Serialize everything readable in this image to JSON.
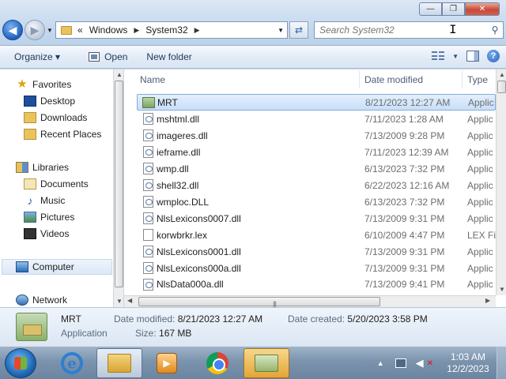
{
  "address": {
    "prefix": "«",
    "crumbs": [
      "Windows",
      "System32"
    ]
  },
  "search": {
    "placeholder": "Search System32"
  },
  "caption": {
    "minimize": "—",
    "maximize": "❐",
    "close": "✕"
  },
  "toolbar": {
    "organize": "Organize ▾",
    "open": "Open",
    "new_folder": "New folder"
  },
  "nav": {
    "favorites": "Favorites",
    "desktop": "Desktop",
    "downloads": "Downloads",
    "recent_places": "Recent Places",
    "libraries": "Libraries",
    "documents": "Documents",
    "music": "Music",
    "pictures": "Pictures",
    "videos": "Videos",
    "computer": "Computer",
    "network": "Network"
  },
  "columns": {
    "name": "Name",
    "date_modified": "Date modified",
    "type": "Type"
  },
  "files": [
    {
      "name": "MRT",
      "date": "8/21/2023 12:27 AM",
      "type": "Applic"
    },
    {
      "name": "mshtml.dll",
      "date": "7/11/2023 1:28 AM",
      "type": "Applic"
    },
    {
      "name": "imageres.dll",
      "date": "7/13/2009 9:28 PM",
      "type": "Applic"
    },
    {
      "name": "ieframe.dll",
      "date": "7/11/2023 12:39 AM",
      "type": "Applic"
    },
    {
      "name": "wmp.dll",
      "date": "6/13/2023 7:32 PM",
      "type": "Applic"
    },
    {
      "name": "shell32.dll",
      "date": "6/22/2023 12:16 AM",
      "type": "Applic"
    },
    {
      "name": "wmploc.DLL",
      "date": "6/13/2023 7:32 PM",
      "type": "Applic"
    },
    {
      "name": "NlsLexicons0007.dll",
      "date": "7/13/2009 9:31 PM",
      "type": "Applic"
    },
    {
      "name": "korwbrkr.lex",
      "date": "6/10/2009 4:47 PM",
      "type": "LEX Fi"
    },
    {
      "name": "NlsLexicons0001.dll",
      "date": "7/13/2009 9:31 PM",
      "type": "Applic"
    },
    {
      "name": "NlsLexicons000a.dll",
      "date": "7/13/2009 9:31 PM",
      "type": "Applic"
    },
    {
      "name": "NlsData000a.dll",
      "date": "7/13/2009 9:41 PM",
      "type": "Applic"
    }
  ],
  "details": {
    "name": "MRT",
    "type": "Application",
    "modified_label": "Date modified:",
    "modified_value": "8/21/2023 12:27 AM",
    "size_label": "Size:",
    "size_value": "167 MB",
    "created_label": "Date created:",
    "created_value": "5/20/2023 3:58 PM"
  },
  "clock": {
    "time": "1:03 AM",
    "date": "12/2/2023"
  }
}
